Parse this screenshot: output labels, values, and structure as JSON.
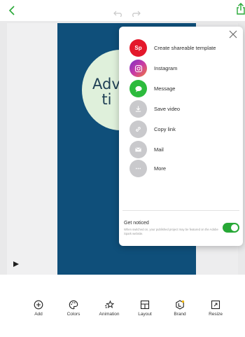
{
  "colors": {
    "accent_green": "#27a836",
    "design_background": "#0f4f7a",
    "circle_fill": "#dff0db",
    "spark_red": "#e4182b",
    "instagram_purple": "#9b2ab7",
    "message_green": "#2dbb3d",
    "gray_icon": "#c9c9cc"
  },
  "toolbar": {
    "back_icon": "chevron-left-icon",
    "undo_icon": "undo-icon",
    "redo_icon": "redo-icon",
    "share_icon": "share-icon"
  },
  "design": {
    "title_text": "Adve\n  ti"
  },
  "share_menu": {
    "items": [
      {
        "label": "Create shareable template",
        "icon": "spark-logo-icon",
        "icon_text": "Sp"
      },
      {
        "label": "Instagram",
        "icon": "instagram-icon"
      },
      {
        "label": "Message",
        "icon": "message-icon"
      },
      {
        "label": "Save video",
        "icon": "download-icon"
      },
      {
        "label": "Copy link",
        "icon": "link-icon"
      },
      {
        "label": "Mail",
        "icon": "mail-icon"
      },
      {
        "label": "More",
        "icon": "more-icon"
      }
    ],
    "get_noticed": {
      "title": "Get noticed",
      "description": "When switched on, your published project may be featured on the Adobe Spark website.",
      "toggle_on": true
    }
  },
  "bottom_toolbar": {
    "tools": [
      {
        "label": "Add",
        "icon": "add-icon"
      },
      {
        "label": "Colors",
        "icon": "palette-icon"
      },
      {
        "label": "Animation",
        "icon": "animation-icon"
      },
      {
        "label": "Layout",
        "icon": "layout-icon"
      },
      {
        "label": "Brand",
        "icon": "brand-icon"
      },
      {
        "label": "Resize",
        "icon": "resize-icon"
      }
    ]
  }
}
